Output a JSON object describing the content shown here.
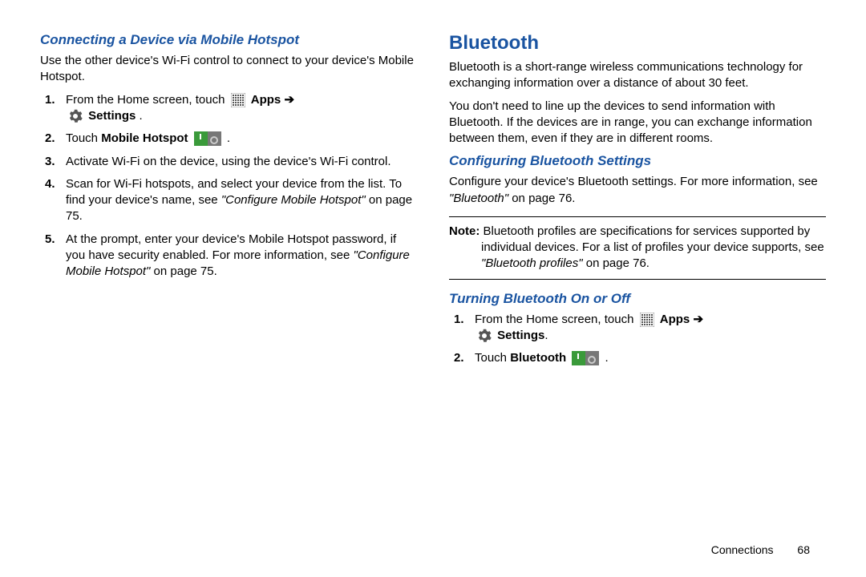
{
  "left": {
    "heading": "Connecting a Device via Mobile Hotspot",
    "intro": "Use the other device's Wi-Fi control to connect to your device's Mobile Hotspot.",
    "step1_a": "From the Home screen, touch ",
    "apps": "Apps",
    "settings": "Settings",
    "step2_a": "Touch ",
    "step2_b": "Mobile Hotspot",
    "step3": "Activate Wi-Fi on the device, using the device's Wi-Fi control.",
    "step4_a": "Scan for Wi-Fi hotspots, and select your device from the list. To find your device's name, see ",
    "step4_ref": "\"Configure Mobile Hotspot\"",
    "step4_b": " on page 75.",
    "step5_a": "At the prompt, enter your device's Mobile Hotspot password, if you have security enabled. For more information, see ",
    "step5_ref": "\"Configure Mobile Hotspot\"",
    "step5_b": " on page 75."
  },
  "right": {
    "chapter": "Bluetooth",
    "p1": "Bluetooth is a short-range wireless communications technology for exchanging information over a distance of about 30 feet.",
    "p2": "You don't need to line up the devices to send information with Bluetooth. If the devices are in range, you can exchange information between them, even if they are in different rooms.",
    "h_conf": "Configuring Bluetooth Settings",
    "conf_a": "Configure your device's Bluetooth settings. For more information, see ",
    "conf_ref": "\"Bluetooth\"",
    "conf_b": " on page 76.",
    "note_label": "Note:",
    "note_a": " Bluetooth profiles are specifications for services supported by individual devices. For a list of profiles your device supports, see ",
    "note_ref": "\"Bluetooth profiles\"",
    "note_b": " on page 76.",
    "h_turn": "Turning Bluetooth On or Off",
    "t_step1_a": "From the Home screen, touch ",
    "t_apps": "Apps",
    "t_settings": "Settings",
    "t_step2_a": "Touch ",
    "t_step2_b": "Bluetooth"
  },
  "footer": {
    "section": "Connections",
    "page": "68"
  }
}
